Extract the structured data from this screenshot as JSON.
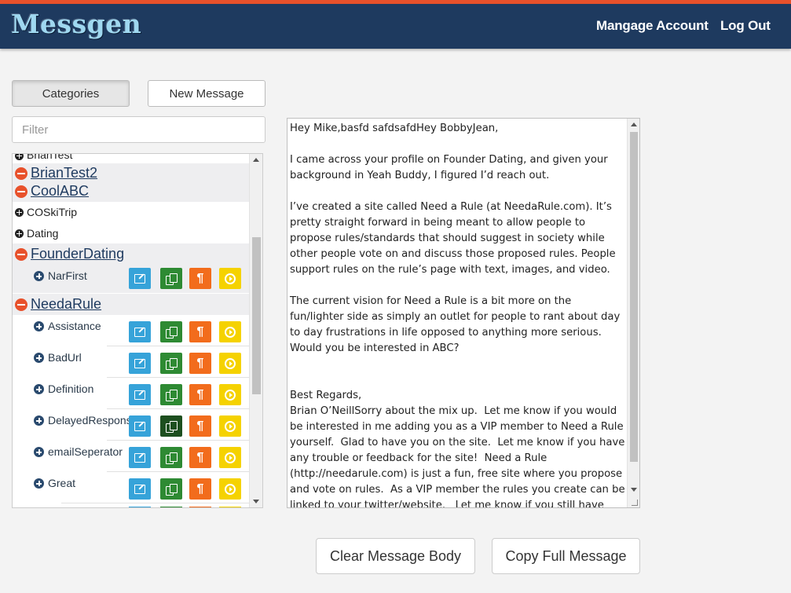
{
  "header": {
    "brand": "Messgen",
    "manage_account": "Mangage Account",
    "log_out": "Log Out"
  },
  "toolbar": {
    "categories_label": "Categories",
    "new_message_label": "New Message"
  },
  "filter": {
    "placeholder": "Filter"
  },
  "categories": [
    {
      "label": "BrianTest",
      "state": "collapsed"
    },
    {
      "label": "BrianTest2",
      "state": "expanded"
    },
    {
      "label": "CoolABC",
      "state": "expanded"
    },
    {
      "label": "COSkiTrip",
      "state": "collapsed"
    },
    {
      "label": "Dating",
      "state": "collapsed"
    },
    {
      "label": "FounderDating",
      "state": "expanded",
      "messages": [
        "NarFirst"
      ]
    },
    {
      "label": "NeedaRule",
      "state": "expanded",
      "messages": [
        "Assistance",
        "BadUrl",
        "Definition",
        "DelayedResponse",
        "emailSeperator",
        "Great"
      ]
    }
  ],
  "message_body": "Hey Mike,basfd safdsafdHey BobbyJean,\n\nI came across your profile on Founder Dating, and given your background in Yeah Buddy, I figured I’d reach out.\n\nI’ve created a site called Need a Rule (at NeedaRule.com). It’s pretty straight forward in being meant to allow people to propose rules/standards that should suggest in society while other people vote on and discuss those proposed rules. People support rules on the rule’s page with text, images, and video.\n\nThe current vision for Need a Rule is a bit more on the fun/lighter side as simply an outlet for people to rant about day to day frustrations in life opposed to anything more serious. Would you be interested in ABC?\n\n\nBest Regards,\nBrian O’NeillSorry about the mix up.  Let me know if you would be interested in me adding you as a VIP member to Need a Rule yourself.  Glad to have you on the site.  Let me know if you have any trouble or feedback for the site!  Need a Rule (http://needarule.com) is just a fun, free site where you propose and vote on rules.  As a VIP member the rules you create can be linked to your twitter/website.   Let me know if you still have",
  "actions": {
    "clear": "Clear Message Body",
    "copy": "Copy Full Message"
  },
  "colors": {
    "navbar": "#1e3a5f",
    "accent": "#e8512b",
    "edit": "#36a3d9",
    "copy": "#2e8a33",
    "paragraph": "#f26c1c",
    "go": "#f5d200"
  },
  "icons": {
    "paragraph_glyph": "¶"
  }
}
